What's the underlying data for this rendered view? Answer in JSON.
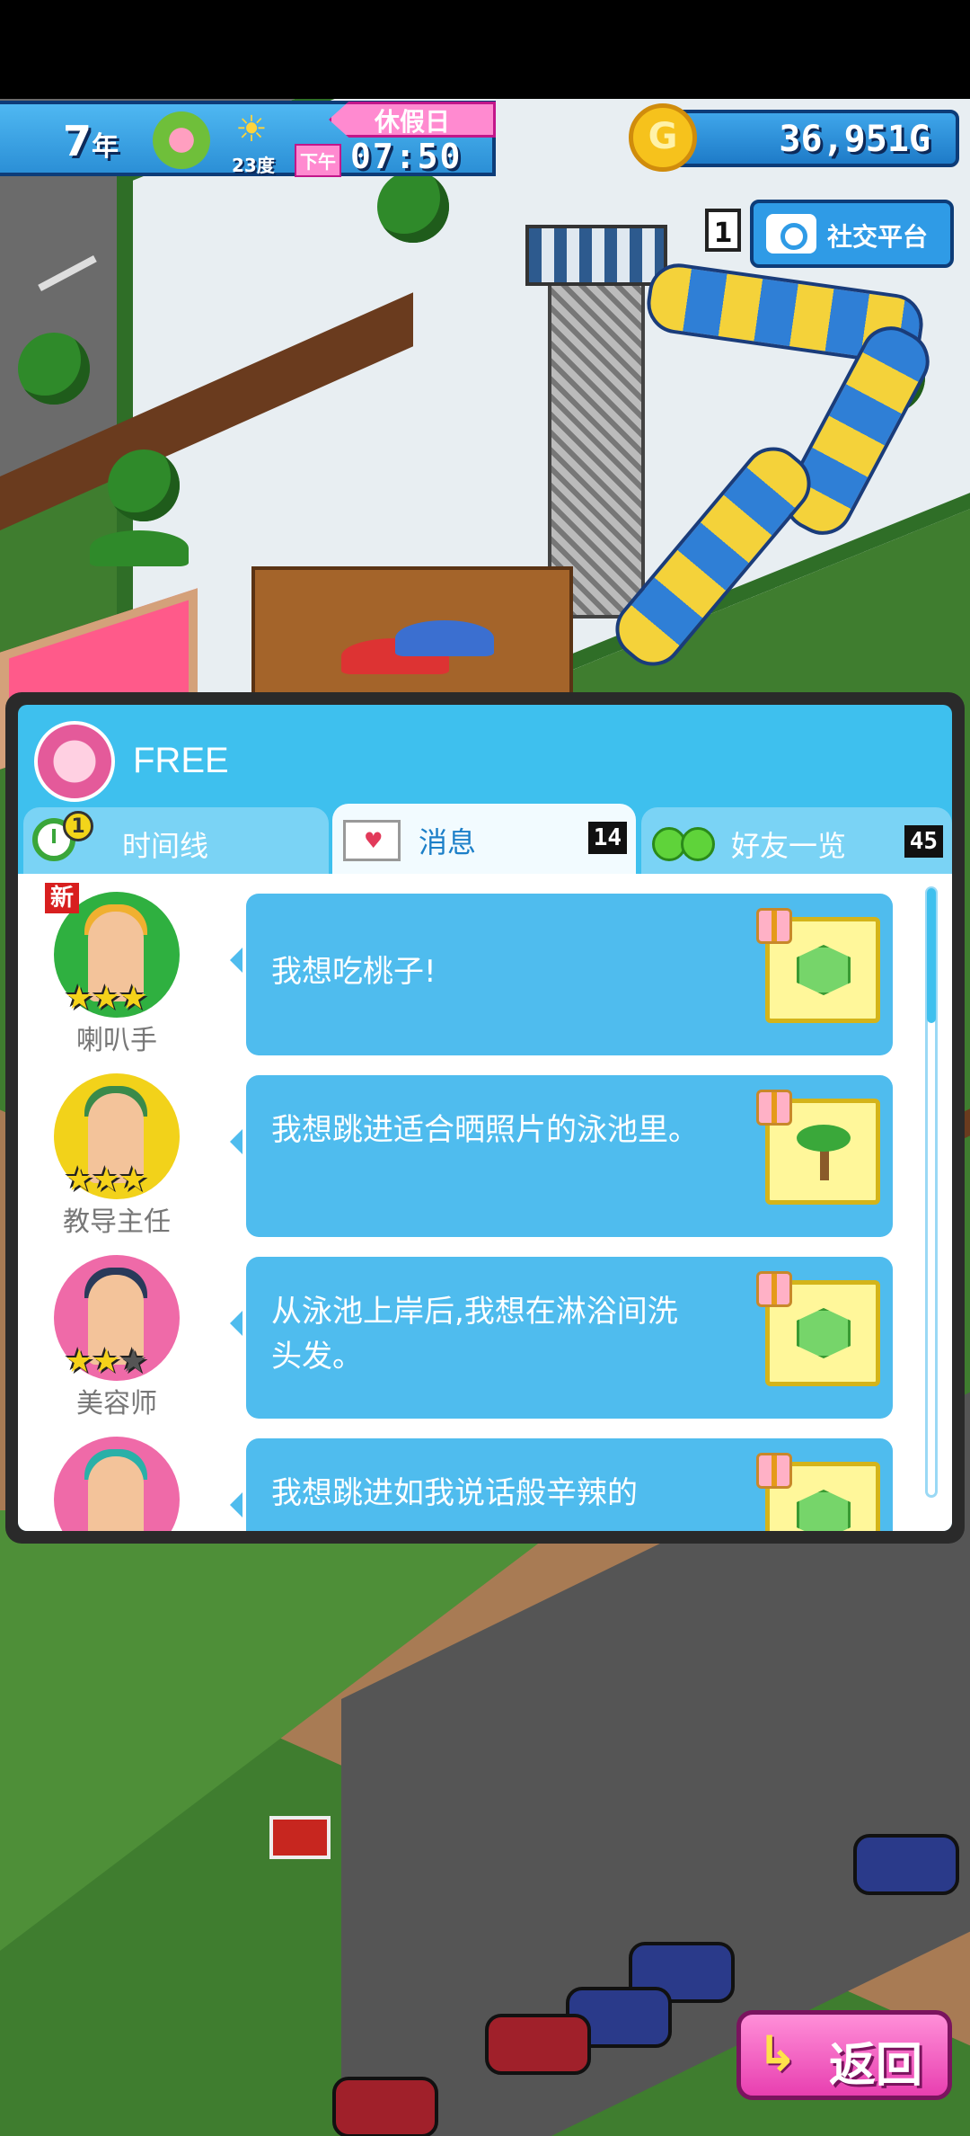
{
  "hud": {
    "year": "7",
    "year_unit": "年",
    "temperature": "23度",
    "holiday": "休假日",
    "ampm": "下午",
    "time": "07:50",
    "money": "36,951G",
    "coin_symbol": "G"
  },
  "social": {
    "count": "1",
    "label": "社交平台"
  },
  "dialog": {
    "user_name": "FREE",
    "tabs": [
      {
        "label": "时间线",
        "badge": "1"
      },
      {
        "label": "消息",
        "count": "14"
      },
      {
        "label": "好友一览",
        "count": "45"
      }
    ],
    "messages": [
      {
        "new_badge": "新",
        "name": "喇叭手",
        "stars": "★★★",
        "dark_stars": "",
        "text": "我想吃桃子!",
        "gift_icon": "green-cube-icon"
      },
      {
        "name": "教导主任",
        "stars": "★★★",
        "dark_stars": "",
        "text": "我想跳进适合晒照片的泳池里。",
        "gift_icon": "palm-tree-icon"
      },
      {
        "name": "美容师",
        "stars": "★★",
        "dark_stars": "★",
        "text": "从泳池上岸后,我想在淋浴间洗头发。",
        "gift_icon": "green-cube-icon"
      },
      {
        "name": "",
        "stars": "",
        "dark_stars": "",
        "text": "我想跳进如我说话般辛辣的",
        "gift_icon": "green-cube-icon"
      }
    ]
  },
  "return_button": {
    "label": "返回"
  },
  "colors": {
    "accent_blue": "#3ec0ee",
    "bubble_blue": "#4fbcee",
    "return_pink": "#e83fb0",
    "gold": "#f6c21c"
  }
}
